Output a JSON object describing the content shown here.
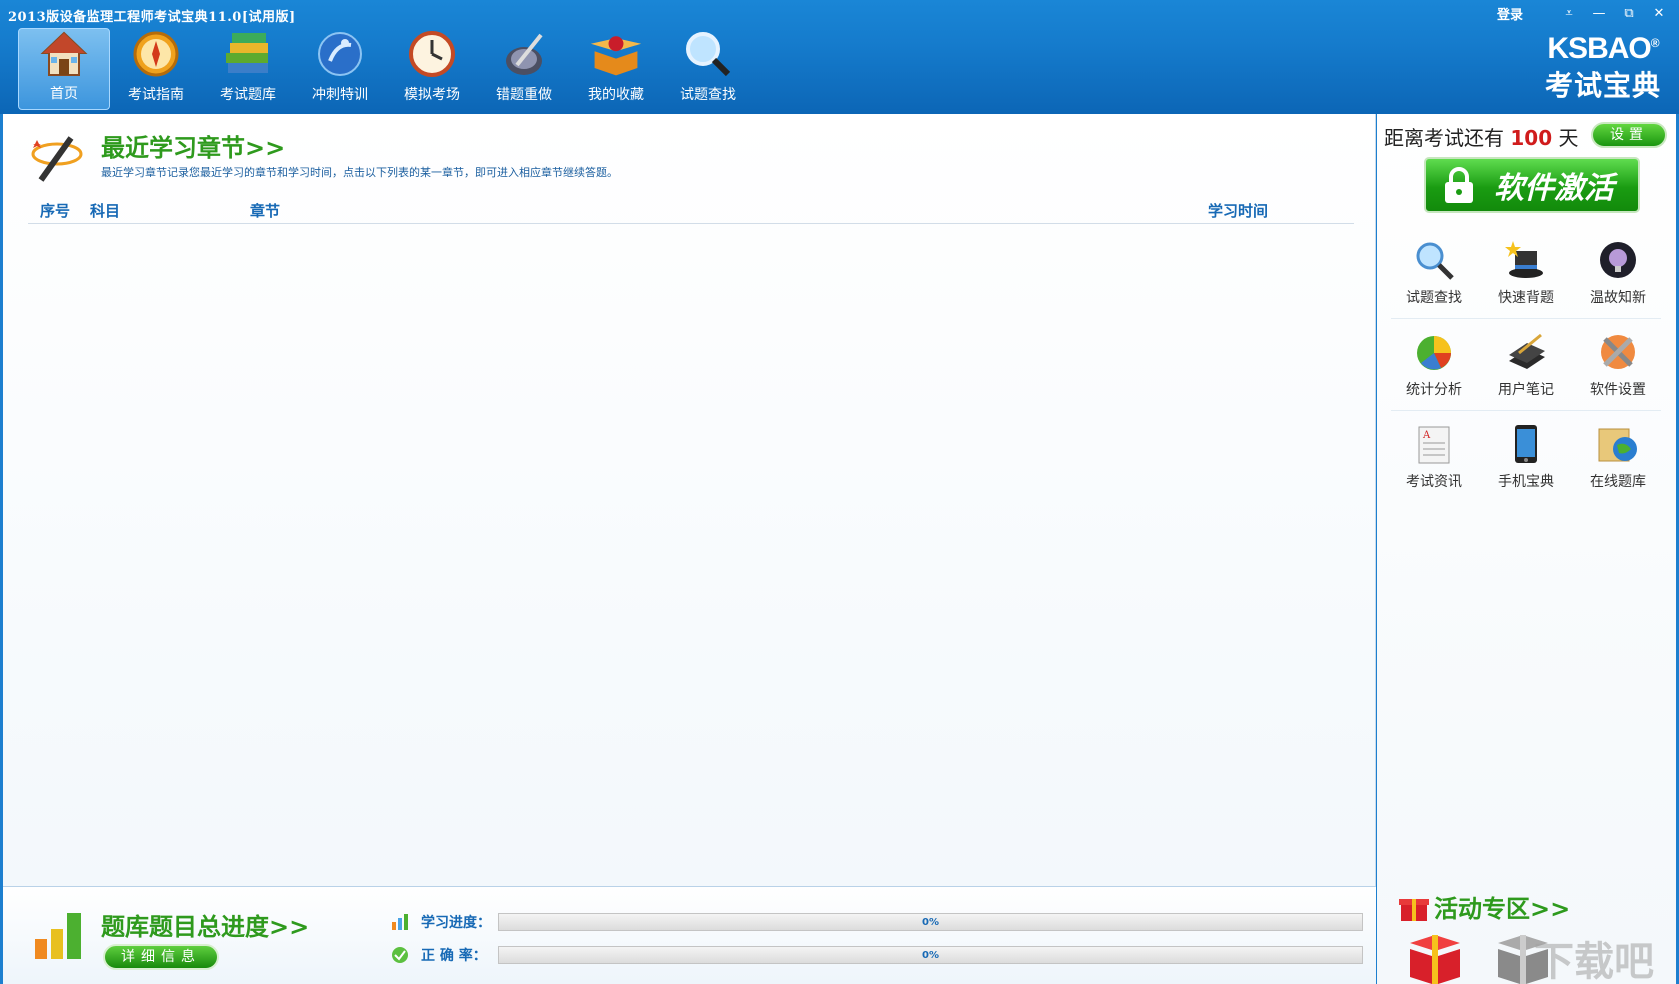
{
  "window": {
    "title": "2013版设备监理工程师考试宝典11.0[试用版]",
    "login_label": "登录",
    "controls": [
      "⩡",
      "—",
      "⧉",
      "✕"
    ]
  },
  "nav": {
    "items": [
      {
        "label": "首页",
        "icon": "home-icon",
        "active": true
      },
      {
        "label": "考试指南",
        "icon": "compass-icon"
      },
      {
        "label": "考试题库",
        "icon": "books-icon"
      },
      {
        "label": "冲刺特训",
        "icon": "sprint-icon"
      },
      {
        "label": "模拟考场",
        "icon": "clock-icon"
      },
      {
        "label": "错题重做",
        "icon": "pen-icon"
      },
      {
        "label": "我的收藏",
        "icon": "gift-box-icon"
      },
      {
        "label": "试题查找",
        "icon": "magnifier-icon"
      }
    ]
  },
  "brand": {
    "en": "KSBAO",
    "reg": "®",
    "cn": "考试宝典"
  },
  "recent": {
    "title": "最近学习章节>>",
    "desc": "最近学习章节记录您最近学习的章节和学习时间，点击以下列表的某一章节，即可进入相应章节继续答题。",
    "columns": {
      "index": "序号",
      "subject": "科目",
      "chapter": "章节",
      "time": "学习时间"
    },
    "rows": []
  },
  "progress": {
    "title": "题库题目总进度>>",
    "detail_button": "详细信息",
    "study_label": "学习进度：",
    "study_value": "0%",
    "study_fraction": 0,
    "accuracy_label": "正 确 率：",
    "accuracy_value": "0%",
    "accuracy_fraction": 0
  },
  "sidebar": {
    "countdown_prefix": "距离考试还有",
    "countdown_days": "100",
    "countdown_suffix": "天",
    "settings_button": "设置",
    "activate_button": "软件激活",
    "tools": [
      [
        {
          "label": "试题查找",
          "icon": "magnifier-icon"
        },
        {
          "label": "快速背题",
          "icon": "magic-hat-icon"
        },
        {
          "label": "温故知新",
          "icon": "lightbulb-icon"
        }
      ],
      [
        {
          "label": "统计分析",
          "icon": "pie-chart-icon"
        },
        {
          "label": "用户笔记",
          "icon": "notebook-icon"
        },
        {
          "label": "软件设置",
          "icon": "settings-tools-icon"
        }
      ],
      [
        {
          "label": "考试资讯",
          "icon": "document-icon"
        },
        {
          "label": "手机宝典",
          "icon": "phone-icon"
        },
        {
          "label": "在线题库",
          "icon": "folder-globe-icon"
        }
      ]
    ],
    "promo_title": "活动专区>>",
    "watermark": "下载吧"
  },
  "colors": {
    "header_blue": "#157bcc",
    "title_green": "#2e9a1d",
    "link_blue": "#1769b5",
    "countdown_red": "#d01c1c",
    "button_green": "#1a9610"
  }
}
